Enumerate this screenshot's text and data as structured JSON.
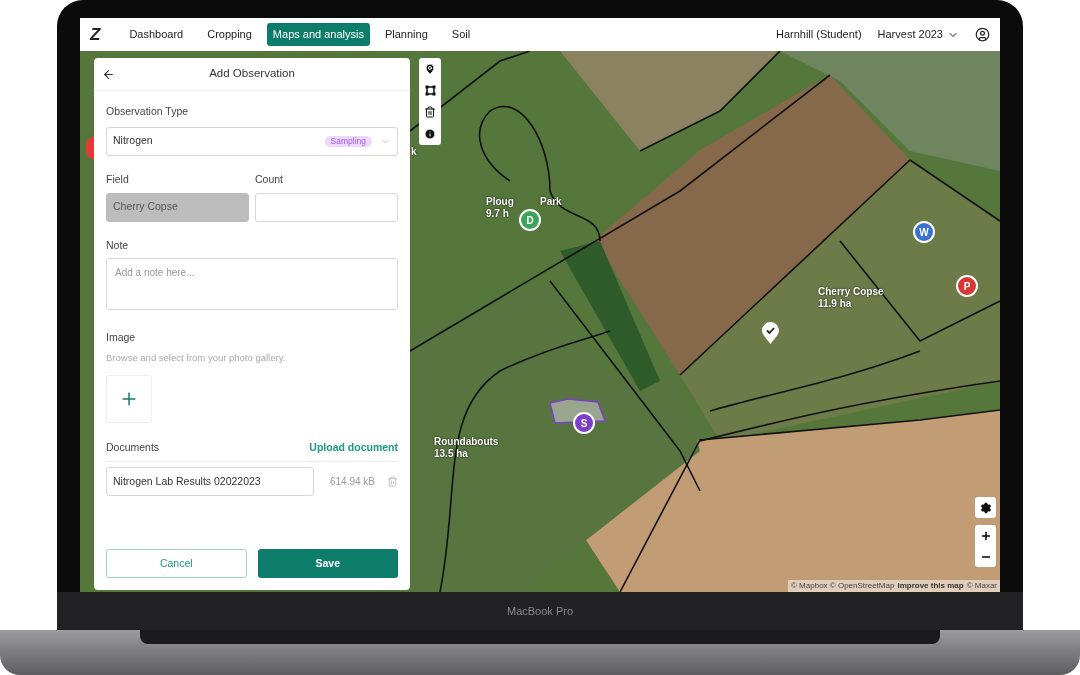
{
  "nav": {
    "logo": "Z",
    "items": [
      {
        "label": "Dashboard",
        "selected": false
      },
      {
        "label": "Cropping",
        "selected": false
      },
      {
        "label": "Maps and analysis",
        "selected": true
      },
      {
        "label": "Planning",
        "selected": false
      },
      {
        "label": "Soil",
        "selected": false
      }
    ],
    "farm": "Harnhill (Student)",
    "season": "Harvest 2023"
  },
  "panel": {
    "title": "Add Observation",
    "observation_type": {
      "label": "Observation Type",
      "value": "Nitrogen",
      "badge": "Sampling"
    },
    "field": {
      "label": "Field",
      "value": "Cherry Copse",
      "disabled": true
    },
    "count": {
      "label": "Count"
    },
    "note": {
      "label": "Note",
      "placeholder": "Add a note here..."
    },
    "image": {
      "label": "Image",
      "hint": "Browse and select from your photo gallery."
    },
    "documents": {
      "label": "Documents",
      "action": "Upload document",
      "items": [
        {
          "name": "Nitrogen Lab Results 02022023",
          "size": "614.94 kB"
        }
      ]
    },
    "cancel": "Cancel",
    "save": "Save"
  },
  "map": {
    "labels": [
      {
        "lines": [
          "k"
        ]
      },
      {
        "lines": [
          "Ploug",
          "9.7 h"
        ],
        "extra": "Park"
      },
      {
        "lines": [
          "Cherry Copse",
          "11.9 ha"
        ]
      },
      {
        "lines": [
          "Roundabouts",
          "13.5 ha"
        ]
      }
    ],
    "markers": [
      {
        "color": "#e53935"
      },
      {
        "letter": "D",
        "color": "#3da35a"
      },
      {
        "letter": "W",
        "color": "#3b72d1"
      },
      {
        "letter": "P",
        "color": "#d93636"
      },
      {
        "letter": "S",
        "color": "#7b3fc9"
      }
    ],
    "attribution": {
      "before": "© Mapbox © OpenStreetMap",
      "link": "Improve this map",
      "after": "© Maxar"
    }
  },
  "device_label": "MacBook Pro"
}
